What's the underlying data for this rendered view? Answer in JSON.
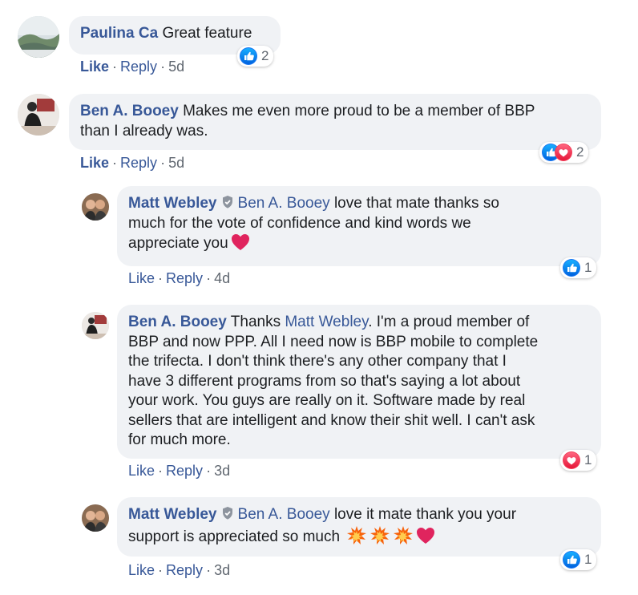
{
  "comments": [
    {
      "author": "Paulina Ca",
      "text": "Great feature",
      "actions": {
        "like": "Like",
        "reply": "Reply",
        "time": "5d"
      },
      "reactions": {
        "types": [
          "like"
        ],
        "count": "2"
      }
    },
    {
      "author": "Ben A. Booey",
      "text_line1": "Makes me even more proud to be a member of BBP",
      "text_line2": "than I already was.",
      "actions": {
        "like": "Like",
        "reply": "Reply",
        "time": "5d"
      },
      "reactions": {
        "types": [
          "like",
          "love"
        ],
        "count": "2"
      }
    }
  ],
  "replies": [
    {
      "author": "Matt Webley",
      "mention": "Ben A. Booey",
      "text_line1": "love that mate thanks so",
      "text_line2": "much for the vote of confidence and kind words we",
      "text_line3": "appreciate you",
      "actions": {
        "like": "Like",
        "reply": "Reply",
        "time": "4d"
      },
      "reactions": {
        "types": [
          "like"
        ],
        "count": "1"
      }
    },
    {
      "author": "Ben A. Booey",
      "text_pre": "Thanks",
      "mention": "Matt Webley",
      "text_line1": ". I'm a proud member of",
      "text_line2": "BBP and now PPP. All I need now is BBP mobile to complete",
      "text_line3": "the trifecta. I don't think there's any other company that I",
      "text_line4": "have 3 different programs from so that's saying a lot about",
      "text_line5": "your work. You guys are really on it. Software made by real",
      "text_line6": "sellers that are intelligent and know their shit well. I can't ask",
      "text_line7": "for much more.",
      "actions": {
        "like": "Like",
        "reply": "Reply",
        "time": "3d"
      },
      "reactions": {
        "types": [
          "love"
        ],
        "count": "1"
      }
    },
    {
      "author": "Matt Webley",
      "mention": "Ben A. Booey",
      "text_line1": "love it mate thank you your",
      "text_line2": "support is appreciated so much",
      "actions": {
        "like": "Like",
        "reply": "Reply",
        "time": "3d"
      },
      "reactions": {
        "types": [
          "like"
        ],
        "count": "1"
      }
    }
  ],
  "more_options": "•••",
  "colors": {
    "link": "#385898",
    "like_blue": "#1877f2",
    "love_red": "#f33e58",
    "bubble": "#f0f2f5"
  }
}
